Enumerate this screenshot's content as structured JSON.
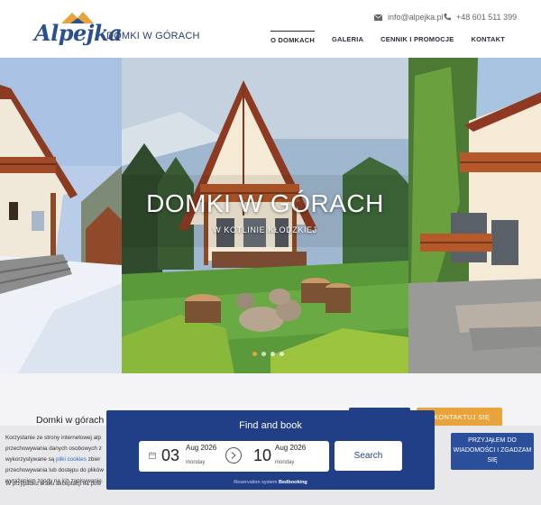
{
  "header": {
    "logo_text": "Alpejka",
    "brand": "DOMKI W GÓRACH",
    "email": "info@alpejka.pl",
    "phone": "+48 601 511 399",
    "nav": [
      {
        "label": "O DOMKACH",
        "active": true
      },
      {
        "label": "GALERIA",
        "active": false
      },
      {
        "label": "CENNIK I PROMOCJE",
        "active": false
      },
      {
        "label": "KONTAKT",
        "active": false
      }
    ]
  },
  "hero": {
    "title": "DOMKI W GÓRACH",
    "subtitle": "W KOTLINIE KŁODZKIEJ",
    "slides_count": 4,
    "active_slide": 0
  },
  "intro": {
    "title": "Domki w górach",
    "contact_button": "SKONTAKTUJ SIĘ"
  },
  "cookie": {
    "text_lines": [
      "Korzystanie ze strony internetowej alp",
      "przechowywania danych osobowych z",
      "wykorzystywane są",
      "przechowywania lub dostępu do plików",
      "wyrażeniem zgody na ich zapisywanie."
    ],
    "link_text": "pliki cookies",
    "link_suffix": " zbier",
    "second_paragraph": "W przypadku braku akceptacji na pow",
    "accept_button": "PRZYJĄŁEM DO WIADOMOŚCI I ZGADZAM SIĘ"
  },
  "booking": {
    "title": "Find and book",
    "checkin": {
      "day": "03",
      "month": "Aug 2026",
      "weekday": "monday"
    },
    "checkout": {
      "day": "10",
      "month": "Aug 2026",
      "weekday": "monday"
    },
    "search_label": "Search",
    "powered_prefix": "Reservation system",
    "powered_brand": "Bedbooking"
  },
  "colors": {
    "primary": "#213f86",
    "accent": "#e8a43a",
    "link": "#2b6dc4"
  }
}
